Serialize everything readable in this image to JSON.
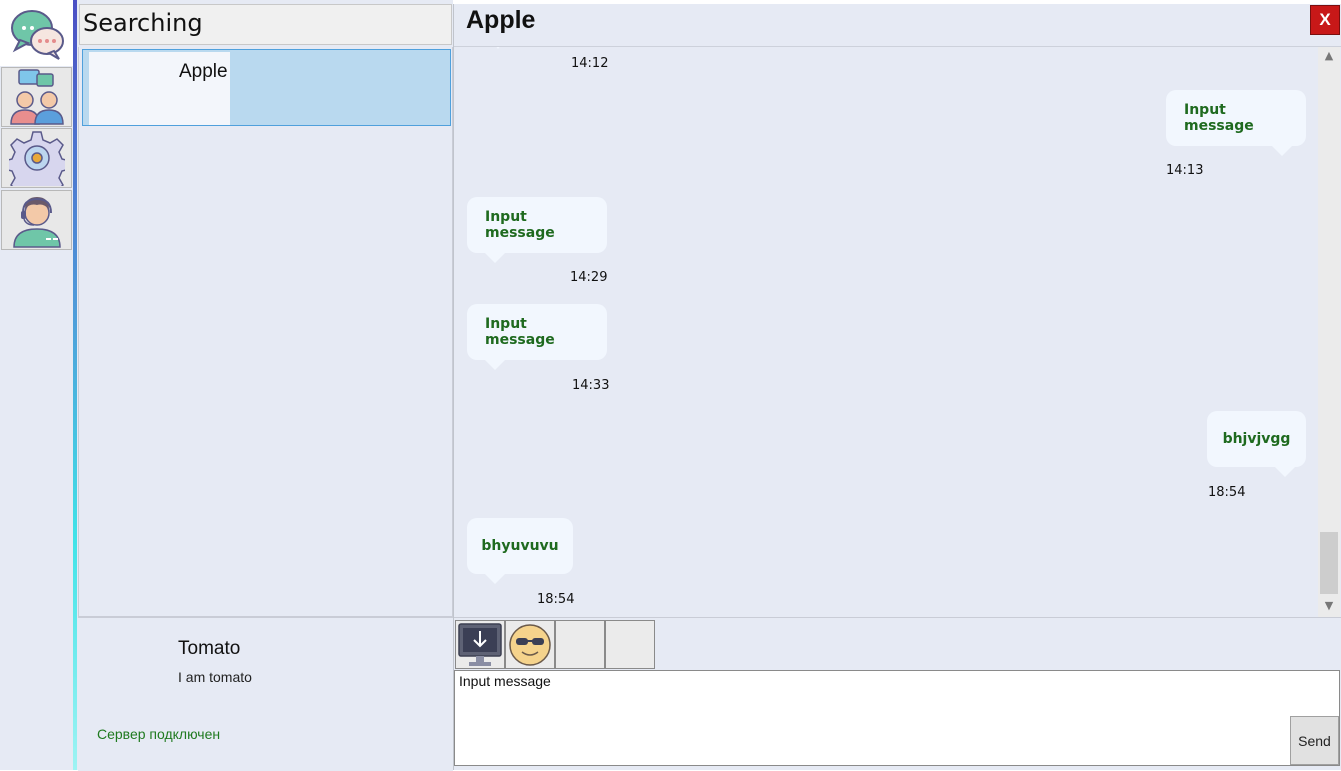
{
  "nav": {
    "items": [
      {
        "icon": "chat-bubbles-icon"
      },
      {
        "icon": "contacts-icon"
      },
      {
        "icon": "settings-gear-icon"
      },
      {
        "icon": "support-agent-icon"
      }
    ]
  },
  "search": {
    "text": "Searching"
  },
  "contacts": [
    {
      "name": "Apple"
    }
  ],
  "profile": {
    "name": "Tomato",
    "status": "I am tomato",
    "server": "Сервер подключен"
  },
  "chat": {
    "title": "Apple",
    "close_label": "X",
    "messages": [
      {
        "side": "left",
        "text": "",
        "time": "14:12"
      },
      {
        "side": "right",
        "text": "Input message",
        "time": "14:13"
      },
      {
        "side": "left",
        "text": "Input message",
        "time": "14:29"
      },
      {
        "side": "left",
        "text": "Input message",
        "time": "14:33"
      },
      {
        "side": "right",
        "text": "bhjvjvgg",
        "time": "18:54"
      },
      {
        "side": "left",
        "text": "bhyuvuvu",
        "time": "18:54"
      }
    ]
  },
  "toolbar": {
    "items": [
      {
        "icon": "download-screen-icon"
      },
      {
        "icon": "emoji-sunglasses-icon"
      },
      {
        "icon": ""
      },
      {
        "icon": ""
      }
    ]
  },
  "composer": {
    "value": "Input message",
    "send_label": "Send"
  },
  "colors": {
    "accent_green": "#1f6a1f",
    "selection_blue": "#b9d9ef",
    "close_red": "#c81818",
    "panel_bg": "#e6eaf4"
  }
}
